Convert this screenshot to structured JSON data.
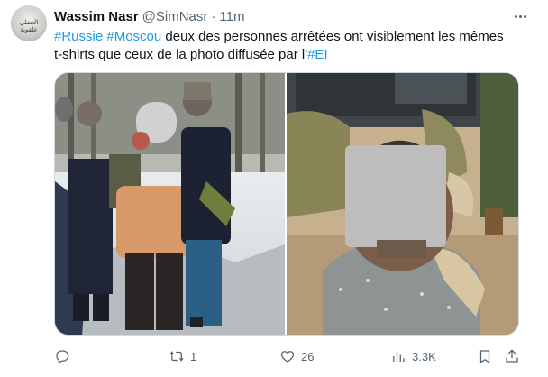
{
  "author": {
    "display_name": "Wassim Nasr",
    "handle": "@SimNasr",
    "separator": "·",
    "time": "11m",
    "avatar_text": "الحقلي علقوبة",
    "avatar_icon": "avatar-logo"
  },
  "tweet": {
    "line1": [
      {
        "text": "#Russie",
        "type": "hashtag"
      },
      {
        "text": " ",
        "type": "text"
      },
      {
        "text": "#Moscou",
        "type": "hashtag"
      },
      {
        "text": " deux des personnes arrêtées ont visiblement les mêmes",
        "type": "text"
      }
    ],
    "line2": [
      {
        "text": "t-shirts que ceux de la photo diffusée par l'",
        "type": "text"
      },
      {
        "text": "#EI",
        "type": "hashtag"
      }
    ]
  },
  "media": {
    "photos": [
      {
        "name": "arrest-photo-left",
        "description_icon": "photo"
      },
      {
        "name": "arrest-photo-right",
        "description_icon": "photo"
      }
    ]
  },
  "actions": {
    "reply": {
      "icon": "reply-icon",
      "count": ""
    },
    "retweet": {
      "icon": "retweet-icon",
      "count": "1"
    },
    "like": {
      "icon": "heart-icon",
      "count": "26"
    },
    "views": {
      "icon": "views-icon",
      "count": "3.3K"
    },
    "bookmark": {
      "icon": "bookmark-icon"
    },
    "share": {
      "icon": "share-icon"
    }
  },
  "colors": {
    "link": "#1d9bf0",
    "secondary_text": "#536471",
    "primary_text": "#0f1419",
    "border": "#cfd9de"
  }
}
